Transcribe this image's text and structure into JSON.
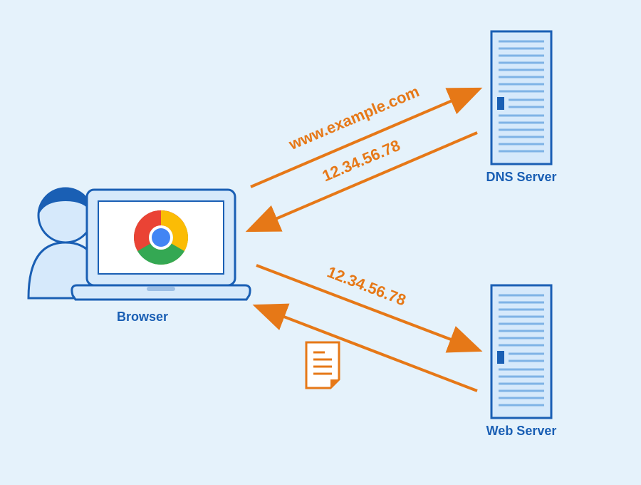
{
  "labels": {
    "browser": "Browser",
    "dns_server": "DNS Server",
    "web_server": "Web Server"
  },
  "arrows": {
    "dns_request": "www.example.com",
    "dns_response": "12.34.56.78",
    "web_request": "12.34.56.78"
  },
  "colors": {
    "background": "#e5f2fb",
    "blue_stroke": "#1a5fb4",
    "blue_fill": "#d6e9fb",
    "orange": "#e67817",
    "chrome_red": "#ea4335",
    "chrome_yellow": "#fbbc05",
    "chrome_green": "#34a853",
    "chrome_blue": "#4285f4"
  }
}
